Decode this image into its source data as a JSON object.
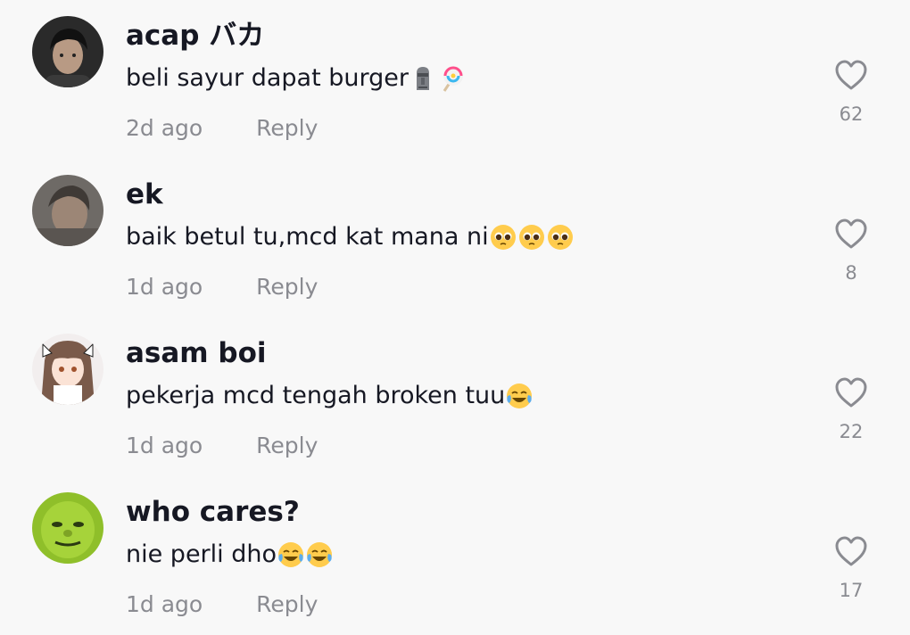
{
  "comments": [
    {
      "username": "acap バカ",
      "text": "beli sayur dapat burger",
      "emojis": [
        "moai-emoji",
        "lollipop-emoji"
      ],
      "time": "2d ago",
      "reply_label": "Reply",
      "likes": "62"
    },
    {
      "username": "ek",
      "text": "baik betul tu,mcd kat mana ni",
      "emojis": [
        "pleading-face-emoji",
        "pleading-face-emoji",
        "pleading-face-emoji"
      ],
      "time": "1d ago",
      "reply_label": "Reply",
      "likes": "8"
    },
    {
      "username": "asam boi",
      "text": "pekerja mcd tengah broken tuu",
      "emojis": [
        "tears-of-joy-emoji"
      ],
      "time": "1d ago",
      "reply_label": "Reply",
      "likes": "22"
    },
    {
      "username": "who cares?",
      "text": "nie perli dho",
      "emojis": [
        "tears-of-joy-emoji",
        "tears-of-joy-emoji"
      ],
      "time": "1d ago",
      "reply_label": "Reply",
      "likes": "17"
    }
  ],
  "icons": {
    "like": "heart-outline-icon"
  },
  "colors": {
    "background": "#f8f8f8",
    "text_primary": "#161823",
    "text_secondary": "#8a8b91"
  }
}
